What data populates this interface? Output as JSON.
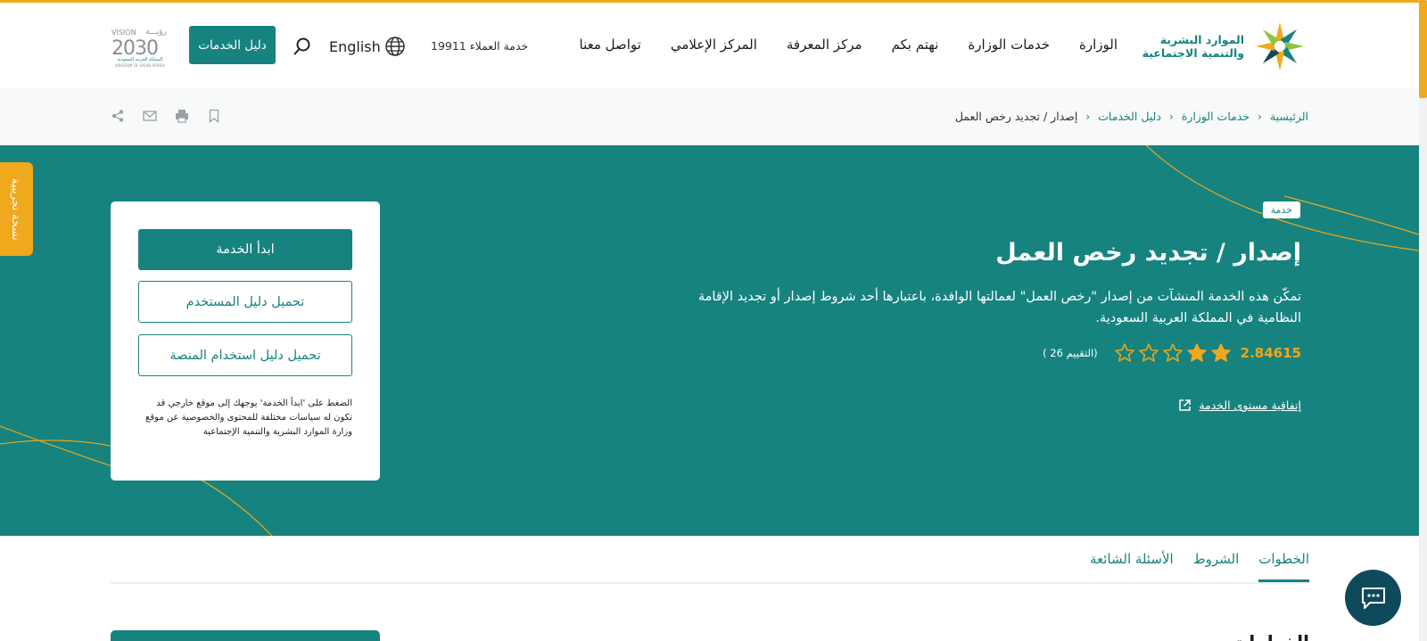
{
  "header": {
    "logo_line1": "الموارد البشرية",
    "logo_line2": "والتنمية الاجتماعية",
    "nav": [
      {
        "label": "الوزارة"
      },
      {
        "label": "خدمات الوزارة"
      },
      {
        "label": "نهتم بكم"
      },
      {
        "label": "مركز المعرفة"
      },
      {
        "label": "المركز الإعلامي"
      },
      {
        "label": "تواصل معنا"
      }
    ],
    "hotline": "خدمة العملاء 19911",
    "language": "English",
    "services_guide": "دليل الخدمات",
    "vision_top": "رؤيـــة",
    "vision_label": "VISION",
    "vision_year": "2030",
    "vision_country_ar": "المملكة العربية السعودية",
    "vision_country_en": "KINGDOM OF SAUDI ARABIA"
  },
  "breadcrumb": {
    "items": [
      "الرئيسية",
      "خدمات الوزارة",
      "دليل الخدمات"
    ],
    "current": "إصدار / تجديد رخص العمل"
  },
  "hero": {
    "badge": "خدمة",
    "title": "إصدار / تجديد رخص العمل",
    "description": "تمكّن هذه الخدمة المنشآت من إصدار \"رخص العمل\" لعمالتها الوافدة، باعتبارها أحد شروط إصدار أو تجديد الإقامة النظامية في المملكة العربية السعودية.",
    "rating_value": "2.84615",
    "rating_stars": 2,
    "rating_max": 5,
    "rating_count": "(التقييم 26 )",
    "sla_link": "إتفاقية مستوى الخدمة"
  },
  "cta": {
    "start": "ابدأ الخدمة",
    "user_guide": "تحميل دليل المستخدم",
    "platform_guide": "تحميل دليل استخدام المنصة",
    "note": "الضغط على 'ابدأ الخدمة' يوجهك إلى موقع خارجي قد تكون له سياسات مختلفة للمحتوى والخصوصية عن موقع وزارة الموارد البشرية والتنمية الإجتماعية"
  },
  "beta_tab": "نسخة تجريبية",
  "tabs": [
    {
      "label": "الخطوات",
      "active": true
    },
    {
      "label": "الشروط",
      "active": false
    },
    {
      "label": "الأسئلة الشائعة",
      "active": false
    }
  ],
  "steps_heading": "الخطوات",
  "colors": {
    "primary": "#16837f",
    "accent": "#f0a81c",
    "chat": "#0f4a5c"
  }
}
